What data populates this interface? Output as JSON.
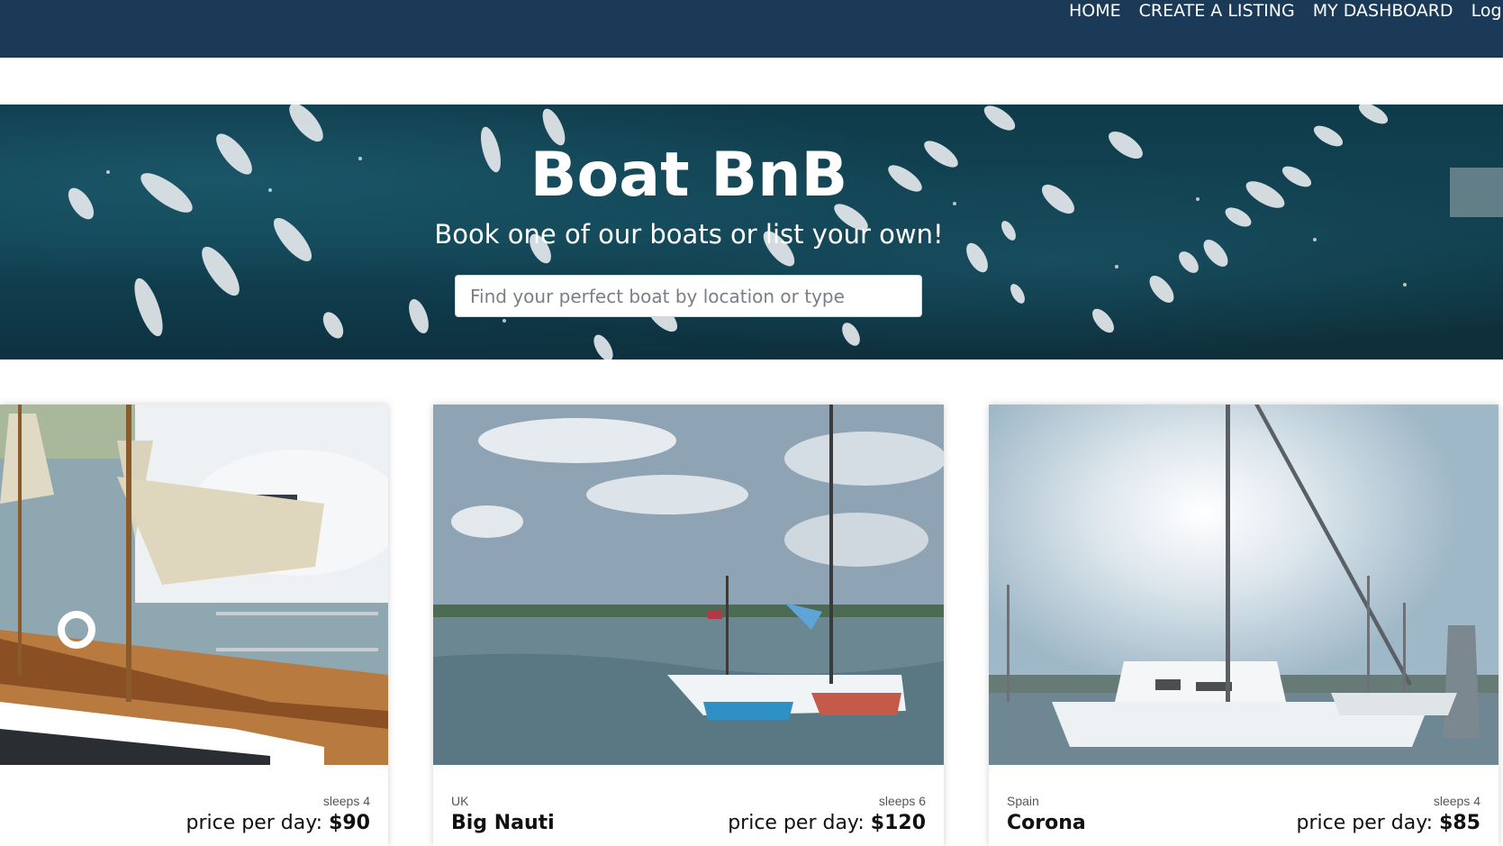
{
  "nav": {
    "links": [
      {
        "label": "HOME"
      },
      {
        "label": "CREATE A LISTING"
      },
      {
        "label": "MY DASHBOARD"
      },
      {
        "label": "Log ou"
      }
    ]
  },
  "hero": {
    "title": "Boat BnB",
    "subtitle": "Book one of our boats or list your own!",
    "search_placeholder": "Find your perfect boat by location or type"
  },
  "listings": [
    {
      "location": "",
      "name": "",
      "sleeps": "sleeps 4",
      "price_label": "price per day: ",
      "price": "$90"
    },
    {
      "location": "UK",
      "name": "Big Nauti",
      "sleeps": "sleeps 6",
      "price_label": "price per day: ",
      "price": "$120"
    },
    {
      "location": "Spain",
      "name": "Corona",
      "sleeps": "sleeps 4",
      "price_label": "price per day: ",
      "price": "$85"
    }
  ],
  "colors": {
    "navbar": "#1b3a57",
    "hero_water": "#124656",
    "text_dark": "#111111"
  }
}
